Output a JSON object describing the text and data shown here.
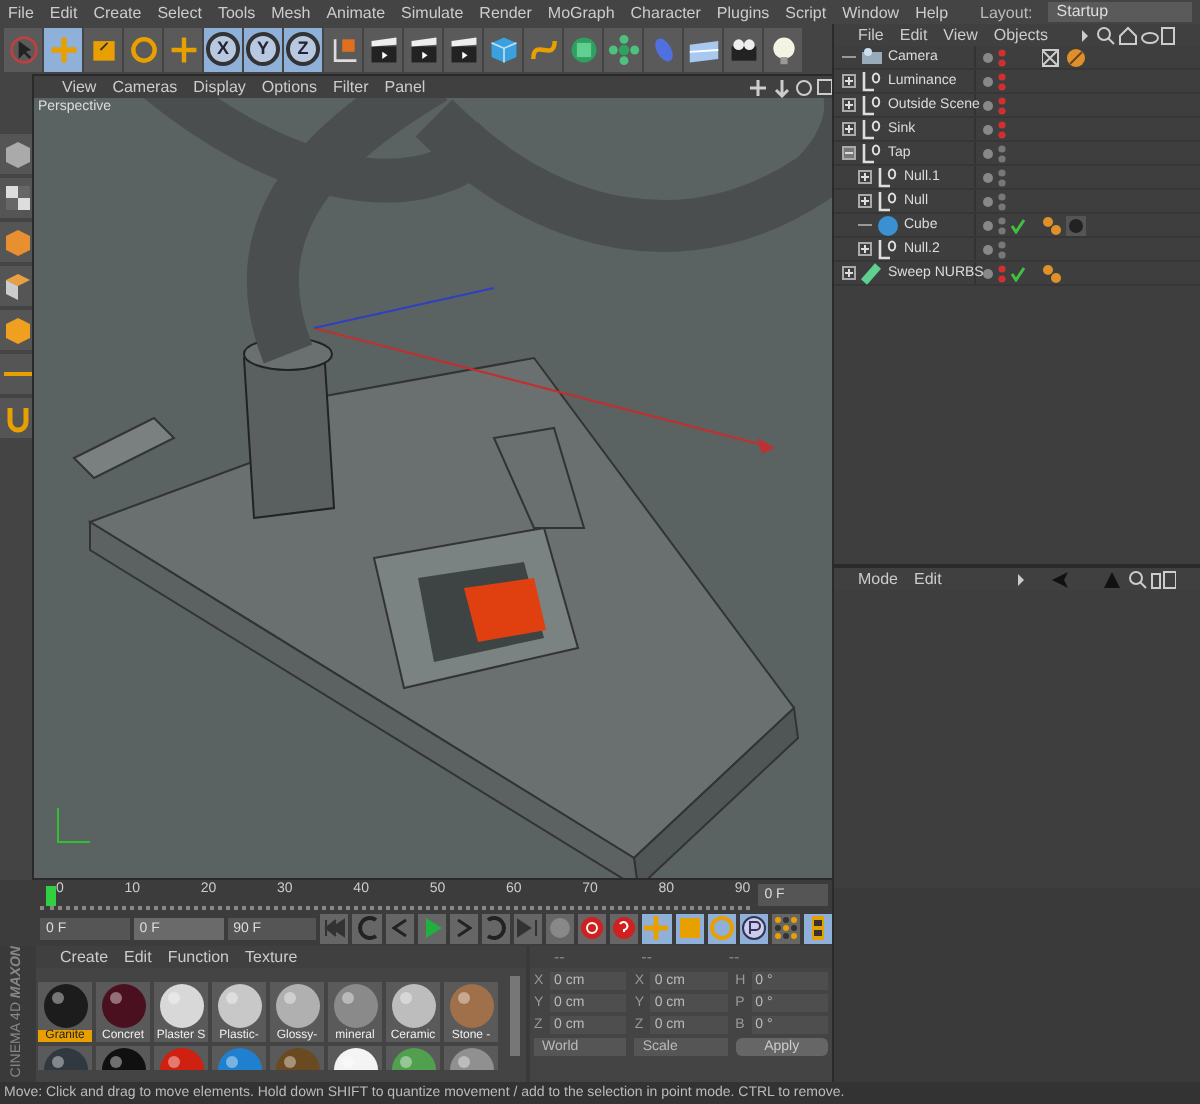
{
  "menu": [
    "File",
    "Edit",
    "Create",
    "Select",
    "Tools",
    "Mesh",
    "Animate",
    "Simulate",
    "Render",
    "MoGraph",
    "Character",
    "Plugins",
    "Script",
    "Window",
    "Help"
  ],
  "layout": {
    "label": "Layout:",
    "value": "Startup"
  },
  "toolbar": {
    "axis_buttons": [
      "X",
      "Y",
      "Z"
    ]
  },
  "viewport": {
    "menu": [
      "View",
      "Cameras",
      "Display",
      "Options",
      "Filter",
      "Panel"
    ],
    "camera": "Perspective"
  },
  "objects": {
    "menu": [
      "File",
      "Edit",
      "View",
      "Objects"
    ],
    "items": [
      {
        "name": "Camera",
        "kind": "camera",
        "expandable": false,
        "expanded": false,
        "hidden": true,
        "checked": false,
        "tags": [
          {
            "kind": "target"
          },
          {
            "kind": "protection"
          }
        ]
      },
      {
        "name": "Luminance",
        "kind": "null",
        "expandable": true,
        "expanded": false,
        "hidden": true,
        "checked": false
      },
      {
        "name": "Outside Scene",
        "kind": "null",
        "expandable": true,
        "expanded": false,
        "hidden": true,
        "checked": false
      },
      {
        "name": "Sink",
        "kind": "null",
        "expandable": true,
        "expanded": false,
        "hidden": true,
        "checked": false
      },
      {
        "name": "Tap",
        "kind": "null",
        "expandable": true,
        "expanded": true,
        "hidden": false,
        "checked": false,
        "children": [
          {
            "name": "Null.1",
            "kind": "null",
            "expandable": true,
            "expanded": false,
            "hidden": false,
            "checked": false
          },
          {
            "name": "Null",
            "kind": "null",
            "expandable": true,
            "expanded": false,
            "hidden": false,
            "checked": false
          },
          {
            "name": "Cube",
            "kind": "cube",
            "expandable": false,
            "expanded": false,
            "hidden": false,
            "checked": true,
            "tags": [
              {
                "kind": "phong"
              },
              {
                "kind": "material"
              }
            ]
          },
          {
            "name": "Null.2",
            "kind": "null",
            "expandable": true,
            "expanded": false,
            "hidden": false,
            "checked": false
          }
        ]
      },
      {
        "name": "Sweep NURBS",
        "kind": "sweep",
        "expandable": true,
        "expanded": false,
        "hidden": true,
        "checked": true,
        "tags": [
          {
            "kind": "phong"
          }
        ]
      }
    ]
  },
  "attributes": {
    "menu": [
      "Mode",
      "Edit"
    ]
  },
  "timeline": {
    "ticks": [
      "0",
      "10",
      "20",
      "30",
      "40",
      "50",
      "60",
      "70",
      "80",
      "90"
    ],
    "current": "0 F"
  },
  "transport": {
    "fields": [
      "0 F",
      "0 F",
      "90 F"
    ]
  },
  "materials": {
    "menu": [
      "Create",
      "Edit",
      "Function",
      "Texture"
    ],
    "items": [
      {
        "name": "Granite",
        "color": "#1c1c1c",
        "selected": true
      },
      {
        "name": "Concret",
        "color": "#4a1020",
        "selected": false
      },
      {
        "name": "Plaster S",
        "color": "#d8d8d8",
        "selected": false
      },
      {
        "name": "Plastic-",
        "color": "#c8c8c8",
        "selected": false
      },
      {
        "name": "Glossy-",
        "color": "#b0b0b0",
        "selected": false
      },
      {
        "name": "mineral",
        "color": "#8a8a8a",
        "selected": false
      },
      {
        "name": "Ceramic",
        "color": "#bdbdbd",
        "selected": false
      },
      {
        "name": "Stone -",
        "color": "#a0704a",
        "selected": false
      }
    ],
    "row_2": [
      {
        "color": "#303840",
        "selected": false
      },
      {
        "color": "#101010",
        "selected": false
      },
      {
        "color": "#d02010",
        "selected": false
      },
      {
        "color": "#2080d0",
        "selected": false
      },
      {
        "color": "#6a4a20",
        "selected": false
      },
      {
        "color": "#f4f4f4",
        "selected": false
      },
      {
        "color": "#50a050",
        "selected": false
      },
      {
        "color": "#909090",
        "selected": false
      }
    ]
  },
  "coordinates": {
    "headers": [
      "--",
      "--",
      "--"
    ],
    "rows": [
      [
        {
          "axis": "X",
          "value": "0 cm"
        },
        {
          "axis": "X",
          "value": "0 cm"
        },
        {
          "axis": "H",
          "value": "0 °"
        }
      ],
      [
        {
          "axis": "Y",
          "value": "0 cm"
        },
        {
          "axis": "Y",
          "value": "0 cm"
        },
        {
          "axis": "P",
          "value": "0 °"
        }
      ],
      [
        {
          "axis": "Z",
          "value": "0 cm"
        },
        {
          "axis": "Z",
          "value": "0 cm"
        },
        {
          "axis": "B",
          "value": "0 °"
        }
      ]
    ],
    "dropdowns": [
      "World",
      "Scale"
    ],
    "apply": "Apply"
  },
  "logo": {
    "brand": "MAXON",
    "product": "CINEMA 4D"
  },
  "status_bar": "Move: Click and drag to move elements. Hold down SHIFT to quantize movement / add to the selection in point mode. CTRL to remove."
}
